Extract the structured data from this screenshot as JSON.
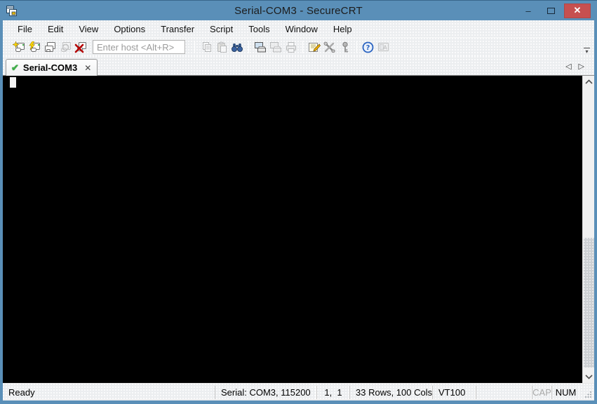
{
  "window": {
    "title": "Serial-COM3 - SecureCRT"
  },
  "menu": {
    "items": [
      "File",
      "Edit",
      "View",
      "Options",
      "Transfer",
      "Script",
      "Tools",
      "Window",
      "Help"
    ]
  },
  "toolbar": {
    "host_placeholder": "Enter host <Alt+R>",
    "buttons": [
      "connect",
      "quick-connect",
      "connect-in-tab",
      "reconnect",
      "disconnect",
      "copy",
      "paste",
      "find",
      "print-screen",
      "print-eject",
      "print",
      "session-options",
      "global-options",
      "key-agent",
      "help",
      "font"
    ]
  },
  "tab_bar": {
    "active_tab": "Serial-COM3"
  },
  "terminal": {
    "content": ""
  },
  "statusbar": {
    "ready": "Ready",
    "connection": "Serial: COM3, 115200",
    "cursor_position": "1,  1",
    "grid_size": "33 Rows, 100 Cols",
    "emulation": "VT100",
    "caps_lock": "CAP",
    "num_lock": "NUM"
  },
  "icons": {
    "minimize": "–",
    "close": "✕",
    "tab_connected": "✔",
    "tab_close": "✕",
    "tab_scroll_left": "◁",
    "tab_scroll_right": "▷",
    "overflow": "▾"
  },
  "colors": {
    "titlebar": "#5a8fb8",
    "close_button": "#c75050",
    "chrome_bg": "#eceef0",
    "terminal_bg": "#000000",
    "tab_check_green": "#3fae49"
  }
}
